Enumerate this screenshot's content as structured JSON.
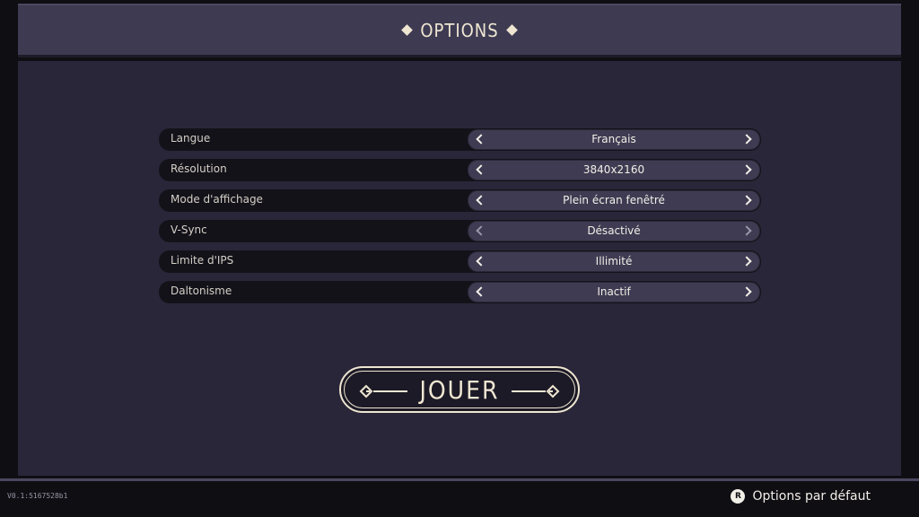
{
  "header": {
    "title": "OPTIONS"
  },
  "options": [
    {
      "label": "Langue",
      "value": "Français"
    },
    {
      "label": "Résolution",
      "value": "3840x2160"
    },
    {
      "label": "Mode d'affichage",
      "value": "Plein écran fenêtré"
    },
    {
      "label": "V-Sync",
      "value": "Désactivé"
    },
    {
      "label": "Limite d'IPS",
      "value": "Illimité"
    },
    {
      "label": "Daltonisme",
      "value": "Inactif"
    }
  ],
  "play": {
    "label": "JOUER"
  },
  "footer": {
    "version": "V0.1:5167528b1",
    "defaults_key": "R",
    "defaults_label": "Options par défaut"
  },
  "colors": {
    "background": "#0f0e13",
    "panel": "#2a2639",
    "header": "#3d3a52",
    "selector": "#3e3b52",
    "accent": "#efe6d2"
  }
}
